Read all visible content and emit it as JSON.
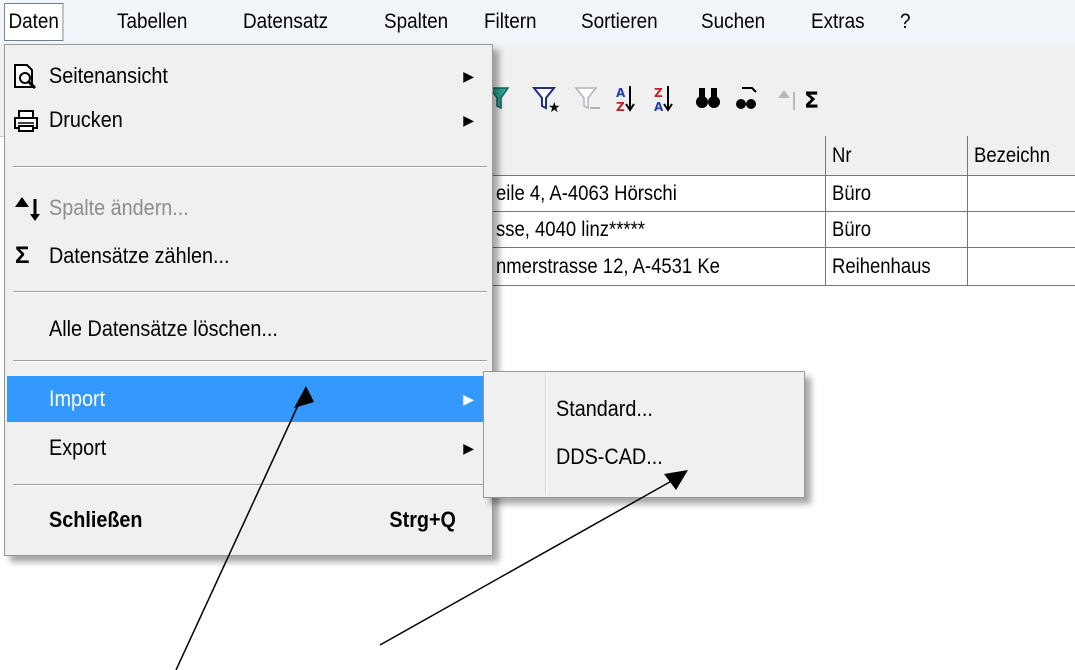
{
  "menubar": [
    "Daten",
    "Tabellen",
    "Datensatz",
    "Spalten",
    "Filtern",
    "Sortieren",
    "Suchen",
    "Extras",
    "?"
  ],
  "toolbar": {
    "icons": [
      "funnel-icon",
      "funnel-star-icon",
      "funnel-clear-icon",
      "sort-ascending-icon",
      "sort-descending-icon",
      "binoculars-icon",
      "find-replace-icon",
      "column-change-icon",
      "sum-icon"
    ],
    "sum_glyph": "Σ"
  },
  "grid": {
    "columns": [
      "",
      "Nr",
      "Bezeichn"
    ],
    "rows": [
      [
        "eile 4, A-4063 Hörschi",
        "Büro",
        ""
      ],
      [
        "sse, 4040 linz*****",
        "Büro",
        ""
      ],
      [
        "nmerstrasse 12, A-4531 Ke",
        "Reihenhaus",
        ""
      ]
    ]
  },
  "menu": {
    "seitenansicht": "Seitenansicht",
    "drucken": "Drucken",
    "spalte_aendern": "Spalte ändern...",
    "zaehlen": "Datensätze zählen...",
    "loeschen": "Alle Datensätze löschen...",
    "import": "Import",
    "export": "Export",
    "schliessen": "Schließen",
    "schliessen_shortcut": "Strg+Q",
    "sum_glyph": "Σ"
  },
  "submenu": {
    "standard": "Standard...",
    "ddscad": "DDS-CAD..."
  }
}
